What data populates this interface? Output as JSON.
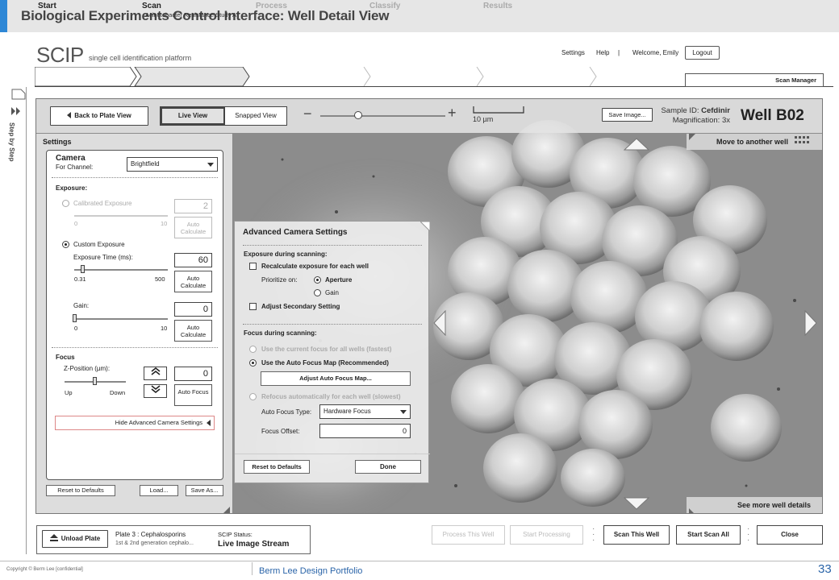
{
  "slide": {
    "title": "Biological Experiments Control Interface: Well Detail View",
    "copyright": "Copyright © Berm Lee [confidential]",
    "portfolio": "Berm Lee Design Portfolio",
    "page_number": "33"
  },
  "app": {
    "logo": "SCIP",
    "logo_sub": "single cell identification platform",
    "links": {
      "settings": "Settings",
      "help": "Help",
      "separator": "|",
      "welcome": "Welcome, Emily"
    },
    "logout": "Logout",
    "scan_manager": "Scan Manager",
    "step_by_step": "Step by Step"
  },
  "steps": [
    {
      "name": "Start",
      "sub": ""
    },
    {
      "name": "Scan",
      "sub": "Acinetobacter Resistance Study A"
    },
    {
      "name": "Process",
      "sub": ""
    },
    {
      "name": "Classify",
      "sub": ""
    },
    {
      "name": "Results",
      "sub": ""
    }
  ],
  "toolbar": {
    "back": "Back to Plate View",
    "live_view": "Live View",
    "snapped_view": "Snapped View",
    "zoom_minus": "−",
    "zoom_plus": "+",
    "zoom_level": 0.3,
    "scale": "10 µm",
    "save_image": "Save Image...",
    "sample_id_label": "Sample ID:",
    "sample_id": "Cefdinir",
    "magnification_label": "Magnification:",
    "magnification": "3x",
    "well": "Well B02"
  },
  "nav": {
    "move_well": "Move to another well",
    "see_more": "See more well details"
  },
  "settings": {
    "title": "Settings",
    "camera": "Camera",
    "for_channel": "For Channel:",
    "channel": "Brightfield",
    "exposure": "Exposure:",
    "calibrated": "Calibrated Exposure",
    "calibrated_value": "2",
    "calibrated_min": "0",
    "calibrated_max": "10",
    "auto_calc": "Auto Calculate",
    "custom": "Custom Exposure",
    "exposure_time": "Exposure Time (ms):",
    "exposure_value": "60",
    "exposure_min": "0.31",
    "exposure_max": "500",
    "gain": "Gain:",
    "gain_value": "0",
    "gain_min": "0",
    "gain_max": "10",
    "focus": "Focus",
    "z_position": "Z-Position (µm):",
    "z_value": "0",
    "z_up": "Up",
    "z_down": "Down",
    "auto_focus": "Auto Focus",
    "hide_advanced": "Hide Advanced Camera Settings",
    "reset": "Reset to Defaults",
    "load": "Load...",
    "save_as": "Save As..."
  },
  "advanced": {
    "title": "Advanced Camera Settings",
    "exposure_scanning": "Exposure during scanning:",
    "recalculate": "Recalculate exposure for each well",
    "prioritize": "Prioritize on:",
    "aperture": "Aperture",
    "gain": "Gain",
    "adjust_secondary": "Adjust Secondary Setting",
    "focus_scanning": "Focus during scanning:",
    "use_current": "Use the current focus for all wells (fastest)",
    "use_map": "Use the Auto Focus Map (Recommended)",
    "adjust_map": "Adjust Auto Focus Map...",
    "refocus": "Refocus automatically for each well (slowest)",
    "af_type_label": "Auto Focus Type:",
    "af_type": "Hardware Focus",
    "offset_label": "Focus Offset:",
    "offset_value": "0",
    "reset": "Reset to Defaults",
    "done": "Done"
  },
  "bottom": {
    "unload": "Unload Plate",
    "plate": "Plate 3 : Cephalosporins",
    "plate_sub": "1st & 2nd generation cephalo...",
    "status_label": "SCIP Status:",
    "status": "Live Image Stream",
    "process_well": "Process This Well",
    "start_processing": "Start Processing",
    "scan_well": "Scan This Well",
    "start_scan_all": "Start Scan All",
    "close": "Close"
  }
}
